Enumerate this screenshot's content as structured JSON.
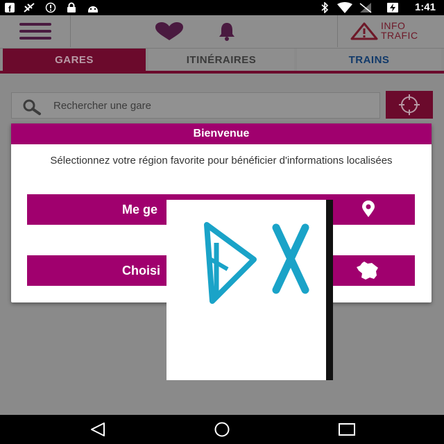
{
  "status_bar": {
    "time": "1:41",
    "left_icons": [
      "facebook-icon",
      "no-signal-icon",
      "info-icon",
      "lock-icon",
      "android-icon"
    ],
    "right_icons": [
      "bluetooth-icon",
      "wifi-icon",
      "no-sim-icon",
      "battery-charging-icon"
    ]
  },
  "app_bar": {
    "info_trafic_line1": "INFO",
    "info_trafic_line2": "TRAFIC",
    "icons": [
      "menu-icon",
      "heart-icon",
      "bell-icon",
      "warning-icon"
    ]
  },
  "tabs": [
    {
      "label": "GARES",
      "selected": true
    },
    {
      "label": "ITINÉRAIRES",
      "selected": false
    },
    {
      "label": "TRAINS",
      "selected": false
    }
  ],
  "search": {
    "placeholder": "Rechercher une gare"
  },
  "dialog": {
    "title": "Bienvenue",
    "message": "Sélectionnez votre région favorite pour bénéficier d'informations localisées",
    "button_geolocate": "Me ge",
    "button_choose": "Choisi"
  },
  "colors": {
    "accent": "#a0006e",
    "dark_accent": "#6b0a2c",
    "dim_background": "#8a8a8a",
    "overlay_logo": "#1aa3c8"
  },
  "nav_bar": {
    "icons": [
      "back-icon",
      "home-icon",
      "recents-icon"
    ]
  }
}
